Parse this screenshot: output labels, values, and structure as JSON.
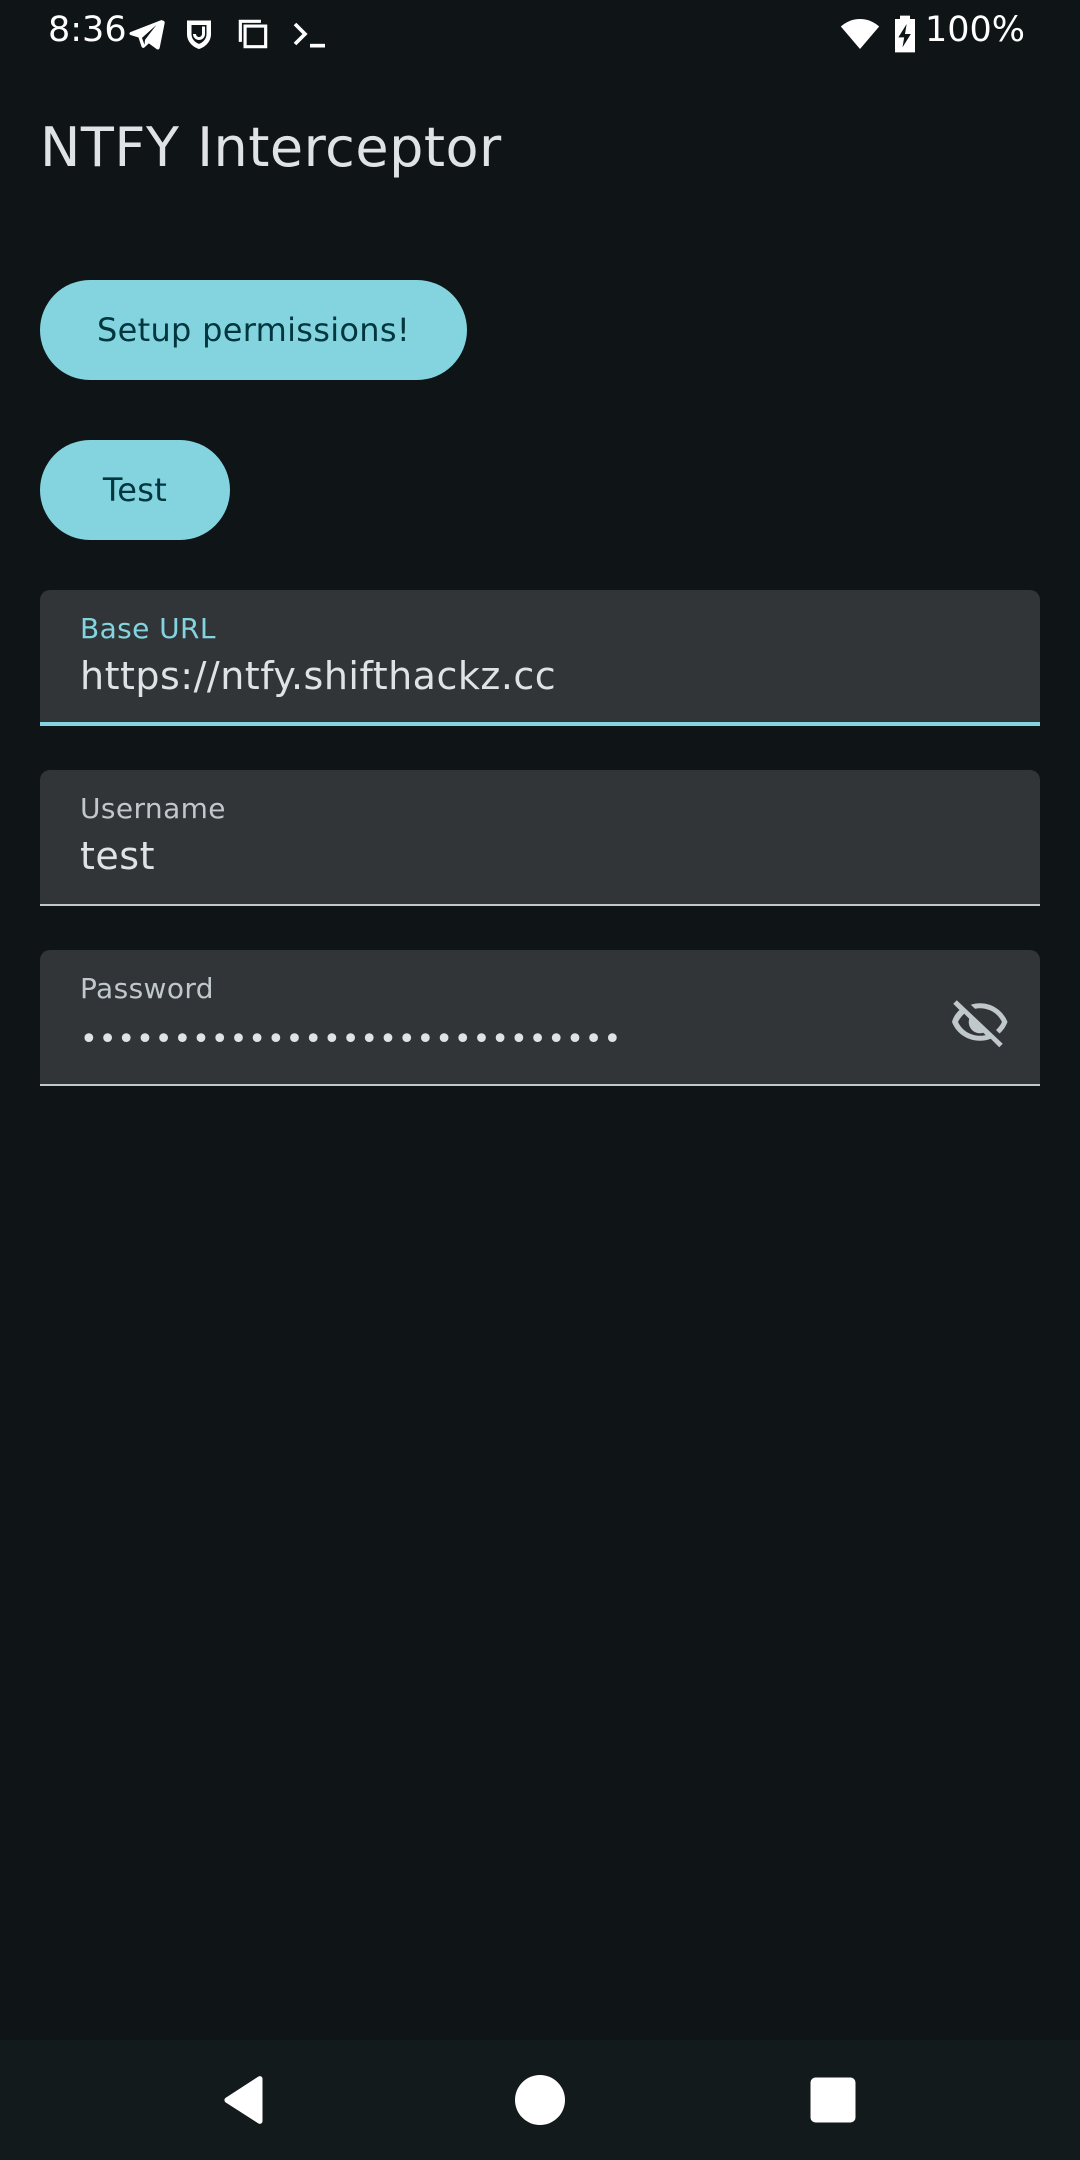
{
  "status_bar": {
    "time": "8:36",
    "battery": "100%",
    "left_icons": [
      "telegram-icon",
      "shield-smile-icon",
      "copy-icon",
      "terminal-icon"
    ],
    "right_icons": [
      "wifi-icon",
      "battery-charging-icon"
    ]
  },
  "app": {
    "title": "NTFY Interceptor"
  },
  "buttons": {
    "setup_label": "Setup permissions!",
    "test_label": "Test"
  },
  "fields": {
    "base_url": {
      "label": "Base URL",
      "value": "https://ntfy.shifthackz.cc",
      "focused": true
    },
    "username": {
      "label": "Username",
      "value": "test"
    },
    "password": {
      "label": "Password",
      "value": "•••••••••••••••••••••••••••••"
    }
  },
  "colors": {
    "background": "#0f1417",
    "accent": "#84d4e0",
    "field_bg": "#313538",
    "text": "#dfe3e6"
  },
  "nav_bar": {
    "icons": [
      "back-icon",
      "home-icon",
      "recents-icon"
    ]
  }
}
